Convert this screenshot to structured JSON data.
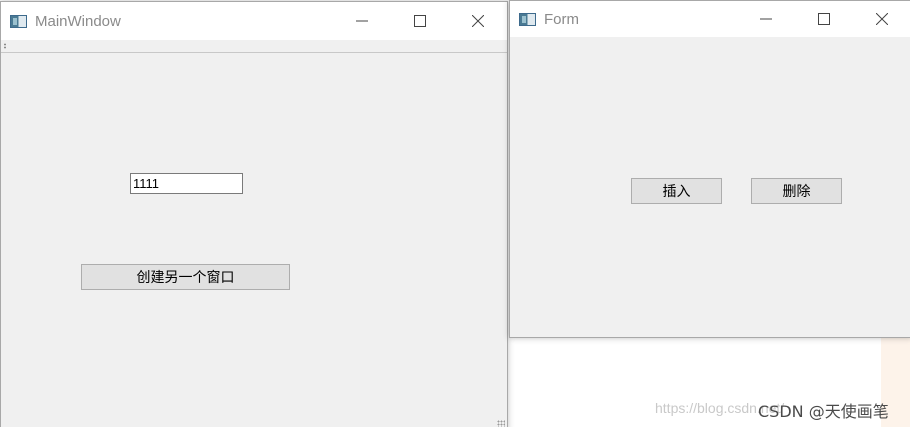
{
  "main_window": {
    "title": "MainWindow",
    "icon": "qt-window-icon",
    "line_edit_value": "1111",
    "create_button_label": "创建另一个窗口"
  },
  "form_window": {
    "title": "Form",
    "icon": "qt-window-icon",
    "insert_button_label": "插入",
    "delete_button_label": "删除"
  },
  "watermark": {
    "url_text": "https://blog.csdn.net/",
    "brand_text": "CSDN @天使画笔"
  },
  "colors": {
    "window_bg": "#f0f0f0",
    "titlebar_bg": "#ffffff",
    "button_bg": "#e1e1e1"
  }
}
